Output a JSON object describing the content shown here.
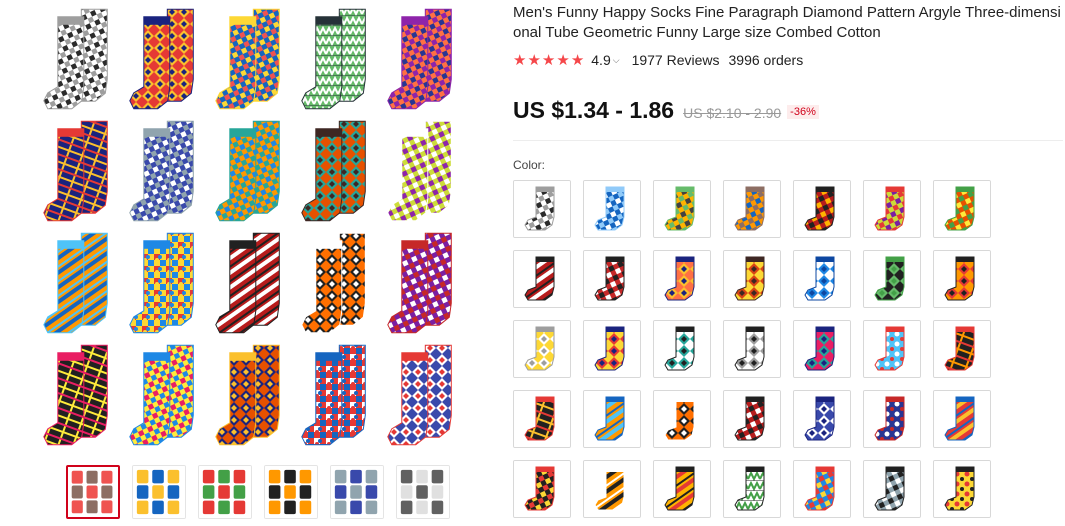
{
  "product": {
    "title": "Men's Funny Happy Socks Fine Paragraph Diamond Pattern Argyle Three-dimensional Tube Geometric Funny Large size Combed Cotton",
    "rating": "4.9",
    "reviews": "1977 Reviews",
    "orders": "3996 orders",
    "price": "US $1.34 - 1.86",
    "original_price": "US $2.10 - 2.90",
    "discount": "-36%",
    "color_label": "Color:"
  },
  "colors": {
    "star": "#f5474a",
    "discount_red": "#d0021b",
    "thumb_active_border": "#d0021b"
  },
  "gallery": {
    "grid_socks": [
      {
        "a": "#ffffff",
        "b": "#2b2b2b",
        "c": "#9e9e9e",
        "pattern": "check"
      },
      {
        "a": "#e53935",
        "b": "#fbc02d",
        "c": "#1a237e",
        "pattern": "diamond"
      },
      {
        "a": "#1565c0",
        "b": "#ef5350",
        "c": "#fdd835",
        "pattern": "check"
      },
      {
        "a": "#ffffff",
        "b": "#66bb6a",
        "c": "#263238",
        "pattern": "zigzag"
      },
      {
        "a": "#ff7043",
        "b": "#283593",
        "c": "#8e24aa",
        "pattern": "check"
      },
      {
        "a": "#1a237e",
        "b": "#fbc02d",
        "c": "#e53935",
        "pattern": "lines"
      },
      {
        "a": "#3949ab",
        "b": "#ffffff",
        "c": "#90a4ae",
        "pattern": "check"
      },
      {
        "a": "#ff9800",
        "b": "#1e88e5",
        "c": "#26a69a",
        "pattern": "check"
      },
      {
        "a": "#e65100",
        "b": "#26a69a",
        "c": "#3e2723",
        "pattern": "diamond"
      },
      {
        "a": "#cddc39",
        "b": "#8e24aa",
        "c": "#ffffff",
        "pattern": "check"
      },
      {
        "a": "#ff9800",
        "b": "#1565c0",
        "c": "#4fc3f7",
        "pattern": "stripe"
      },
      {
        "a": "#fdd835",
        "b": "#e53935",
        "c": "#1e88e5",
        "pattern": "puzzle"
      },
      {
        "a": "#b71c1c",
        "b": "#ffffff",
        "c": "#212121",
        "pattern": "stripe"
      },
      {
        "a": "#ff6f00",
        "b": "#212121",
        "c": "#ffffff",
        "pattern": "diamond"
      },
      {
        "a": "#7b1fa2",
        "b": "#ffffff",
        "c": "#c62828",
        "pattern": "check"
      },
      {
        "a": "#212121",
        "b": "#ffeb3b",
        "c": "#e91e63",
        "pattern": "lines"
      },
      {
        "a": "#ffeb3b",
        "b": "#e91e63",
        "c": "#1e88e5",
        "pattern": "check"
      },
      {
        "a": "#e65100",
        "b": "#1a237e",
        "c": "#fbc02d",
        "pattern": "diamond"
      },
      {
        "a": "#e53935",
        "b": "#ffffff",
        "c": "#1565c0",
        "pattern": "puzzle"
      },
      {
        "a": "#3949ab",
        "b": "#ffffff",
        "c": "#e53935",
        "pattern": "diamond"
      }
    ],
    "thumbnails": [
      {
        "label": "thumb-1",
        "bg": "#8d6e63",
        "alt": "#ef5350"
      },
      {
        "label": "thumb-2",
        "bg": "#1565c0",
        "alt": "#fbc02d"
      },
      {
        "label": "thumb-3",
        "bg": "#43a047",
        "alt": "#e53935"
      },
      {
        "label": "thumb-4",
        "bg": "#212121",
        "alt": "#ff9800"
      },
      {
        "label": "thumb-5",
        "bg": "#3949ab",
        "alt": "#90a4ae"
      },
      {
        "label": "thumb-6",
        "bg": "#e0e0e0",
        "alt": "#616161"
      }
    ]
  },
  "swatches": [
    {
      "a": "#ffffff",
      "b": "#2b2b2b",
      "c": "#9e9e9e",
      "pattern": "check"
    },
    {
      "a": "#1565c0",
      "b": "#ffffff",
      "c": "#90caf9",
      "pattern": "check"
    },
    {
      "a": "#ffb300",
      "b": "#424242",
      "c": "#66bb6a",
      "pattern": "check"
    },
    {
      "a": "#ff9800",
      "b": "#1565c0",
      "c": "#8d6e63",
      "pattern": "check"
    },
    {
      "a": "#b71c1c",
      "b": "#ffb300",
      "c": "#212121",
      "pattern": "check"
    },
    {
      "a": "#cddc39",
      "b": "#7b1fa2",
      "c": "#e53935",
      "pattern": "check"
    },
    {
      "a": "#e65100",
      "b": "#ffeb3b",
      "c": "#43a047",
      "pattern": "check"
    },
    {
      "a": "#b71c1c",
      "b": "#ffffff",
      "c": "#212121",
      "pattern": "stripe"
    },
    {
      "a": "#c62828",
      "b": "#ffffff",
      "c": "#212121",
      "pattern": "check"
    },
    {
      "a": "#ff7043",
      "b": "#fbc02d",
      "c": "#1a237e",
      "pattern": "diamond"
    },
    {
      "a": "#fdd835",
      "b": "#d84315",
      "c": "#3e2723",
      "pattern": "diamond"
    },
    {
      "a": "#ffffff",
      "b": "#1e88e5",
      "c": "#0d47a1",
      "pattern": "diamond"
    },
    {
      "a": "#212121",
      "b": "#66bb6a",
      "c": "#43a047",
      "pattern": "diamond"
    },
    {
      "a": "#ff9800",
      "b": "#e53935",
      "c": "#212121",
      "pattern": "diamond"
    },
    {
      "a": "#fdd835",
      "b": "#ffffff",
      "c": "#9e9e9e",
      "pattern": "diamond"
    },
    {
      "a": "#fdd835",
      "b": "#e53935",
      "c": "#1a237e",
      "pattern": "diamond"
    },
    {
      "a": "#ffffff",
      "b": "#26a69a",
      "c": "#212121",
      "pattern": "diamond"
    },
    {
      "a": "#ffffff",
      "b": "#9e9e9e",
      "c": "#212121",
      "pattern": "diamond"
    },
    {
      "a": "#e91e63",
      "b": "#26a69a",
      "c": "#1a237e",
      "pattern": "diamond"
    },
    {
      "a": "#4fc3f7",
      "b": "#ffffff",
      "c": "#e53935",
      "pattern": "dots"
    },
    {
      "a": "#212121",
      "b": "#ff9800",
      "c": "#e53935",
      "pattern": "lines"
    },
    {
      "a": "#212121",
      "b": "#fbc02d",
      "c": "#e53935",
      "pattern": "lines"
    },
    {
      "a": "#ff9800",
      "b": "#4fc3f7",
      "c": "#1565c0",
      "pattern": "stripe"
    },
    {
      "a": "#ff6f00",
      "b": "#212121",
      "c": "#ffffff",
      "pattern": "diamond"
    },
    {
      "a": "#b71c1c",
      "b": "#ffffff",
      "c": "#212121",
      "pattern": "check"
    },
    {
      "a": "#3949ab",
      "b": "#ffffff",
      "c": "#1a237e",
      "pattern": "diamond"
    },
    {
      "a": "#283593",
      "b": "#ffffff",
      "c": "#c62828",
      "pattern": "dots"
    },
    {
      "a": "#e53935",
      "b": "#fbc02d",
      "c": "#1565c0",
      "pattern": "stripe"
    },
    {
      "a": "#212121",
      "b": "#fdd835",
      "c": "#e53935",
      "pattern": "check"
    },
    {
      "a": "#ff9800",
      "b": "#212121",
      "c": "#ffffff",
      "pattern": "stripe"
    },
    {
      "a": "#ffb300",
      "b": "#e53935",
      "c": "#212121",
      "pattern": "stripe"
    },
    {
      "a": "#43a047",
      "b": "#ffffff",
      "c": "#212121",
      "pattern": "zigzag"
    },
    {
      "a": "#1e88e5",
      "b": "#fdd835",
      "c": "#e53935",
      "pattern": "check"
    },
    {
      "a": "#90a4ae",
      "b": "#ffffff",
      "c": "#212121",
      "pattern": "check"
    },
    {
      "a": "#fdd835",
      "b": "#e53935",
      "c": "#212121",
      "pattern": "dots"
    }
  ]
}
